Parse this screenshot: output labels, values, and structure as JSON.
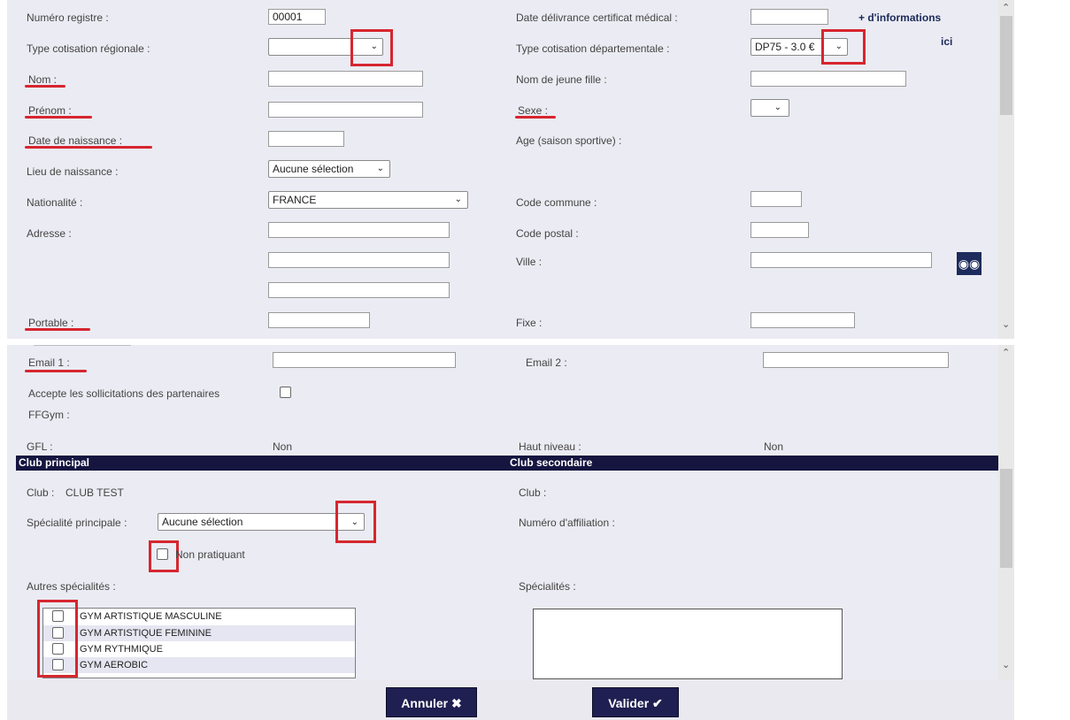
{
  "panel1": {
    "registre_label": "Numéro registre :",
    "registre_value": "00001",
    "cert_label": "Date délivrance certificat médical :",
    "more_info": "+ d'informations",
    "ici": "ici",
    "cot_reg_label": "Type cotisation régionale :",
    "cot_dep_label": "Type cotisation départementale :",
    "cot_dep_value": "DP75 - 3.0 €",
    "nom_label": "Nom :",
    "jeune_fille_label": "Nom de jeune fille :",
    "prenom_label": "Prénom :",
    "sexe_label": "Sexe :",
    "naissance_label": "Date de naissance :",
    "age_label": "Age (saison sportive) :",
    "lieu_label": "Lieu de naissance :",
    "lieu_value": "Aucune sélection",
    "nationalite_label": "Nationalité :",
    "nationalite_value": "FRANCE",
    "code_commune_label": "Code commune :",
    "adresse_label": "Adresse :",
    "code_postal_label": "Code postal :",
    "ville_label": "Ville :",
    "portable_label": "Portable :",
    "fixe_label": "Fixe :"
  },
  "panel2": {
    "email1_label": "Email 1 :",
    "email2_label": "Email 2 :",
    "sollicitations_label": "Accepte les sollicitations des partenaires",
    "ffgym_label": "FFGym :",
    "gfl_label": "GFL :",
    "gfl_value": "Non",
    "haut_niveau_label": "Haut niveau :",
    "haut_niveau_value": "Non",
    "club_principal_header": "Club principal",
    "club_secondaire_header": "Club secondaire",
    "club_label": "Club :",
    "club_value": "CLUB TEST",
    "club2_label": "Club :",
    "specialite_label": "Spécialité principale :",
    "specialite_value": "Aucune sélection",
    "affiliation_label": "Numéro d'affiliation :",
    "non_pratiquant_label": "Non pratiquant",
    "autres_label": "Autres spécialités :",
    "specialites_label": "Spécialités :",
    "specialites": [
      "GYM ARTISTIQUE MASCULINE",
      "GYM ARTISTIQUE FEMININE",
      "GYM RYTHMIQUE",
      "GYM AEROBIC"
    ]
  },
  "buttons": {
    "annuler": "Annuler ✖",
    "valider": "Valider ✔"
  },
  "icons": {
    "binoculars": "binoculars-icon",
    "chevron": "chevron-down-icon"
  },
  "colors": {
    "header_bg": "#151540",
    "annotation_red": "#d6262f",
    "panel_bg": "#ebebf3"
  }
}
